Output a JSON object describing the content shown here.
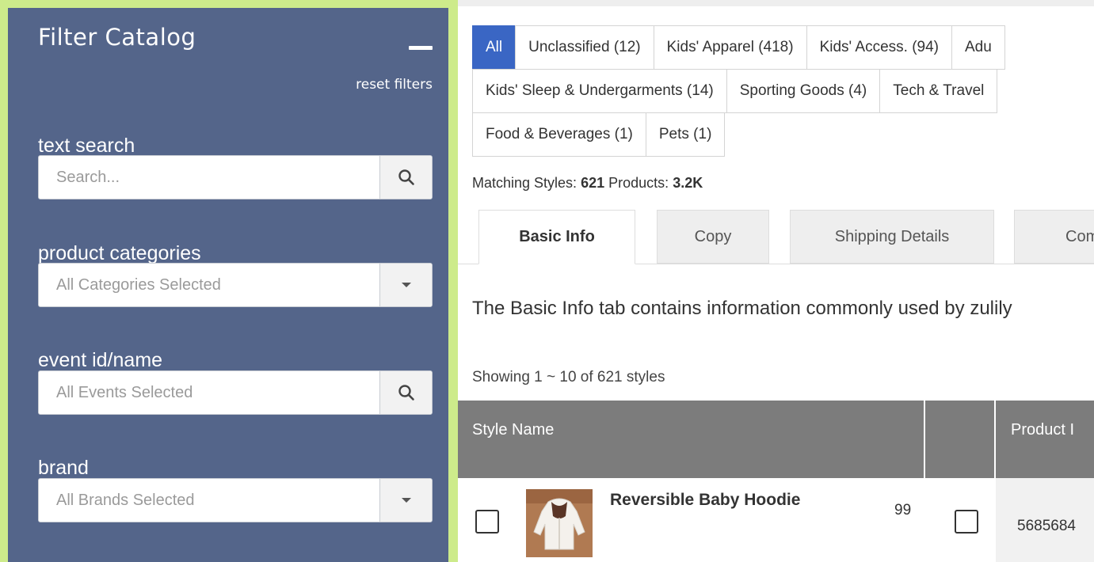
{
  "sidebar": {
    "title": "Filter Catalog",
    "collapse_icon": "minus-icon",
    "reset_label": "reset filters",
    "fields": {
      "text_search": {
        "label": "text search",
        "placeholder": "Search...",
        "button_icon": "search-icon"
      },
      "product_categories": {
        "label": "product categories",
        "placeholder": "All Categories Selected",
        "button_icon": "caret-down-icon"
      },
      "event": {
        "label": "event id/name",
        "placeholder": "All Events Selected",
        "button_icon": "search-icon"
      },
      "brand": {
        "label": "brand",
        "placeholder": "All Brands Selected",
        "button_icon": "caret-down-icon"
      }
    }
  },
  "category_pills": {
    "row1": [
      "All",
      "Unclassified (12)",
      "Kids' Apparel (418)",
      "Kids' Access. (94)",
      "Adu"
    ],
    "row2": [
      "Kids' Sleep & Undergarments (14)",
      "Sporting Goods (4)",
      "Tech & Travel"
    ],
    "row3": [
      "Food & Beverages (1)",
      "Pets (1)"
    ],
    "active": "All"
  },
  "matching": {
    "styles_label": "Matching Styles:",
    "styles_value": "621",
    "products_label": "Products:",
    "products_value": "3.2K"
  },
  "tabs": [
    "Basic Info",
    "Copy",
    "Shipping Details",
    "Com"
  ],
  "description": "The Basic Info tab contains information commonly used by zulily",
  "showing": "Showing 1 ~ 10 of 621 styles",
  "table": {
    "headers": [
      "Style Name",
      "",
      "Product I"
    ],
    "rows": [
      {
        "style_name": "Reversible Baby Hoodie",
        "count": "99",
        "product_id": "5685684"
      }
    ]
  },
  "colors": {
    "sidebar_bg": "#54658a",
    "sidebar_border": "#cdeb8b",
    "active_pill": "#3a66c4",
    "table_header": "#7c7c7c"
  }
}
